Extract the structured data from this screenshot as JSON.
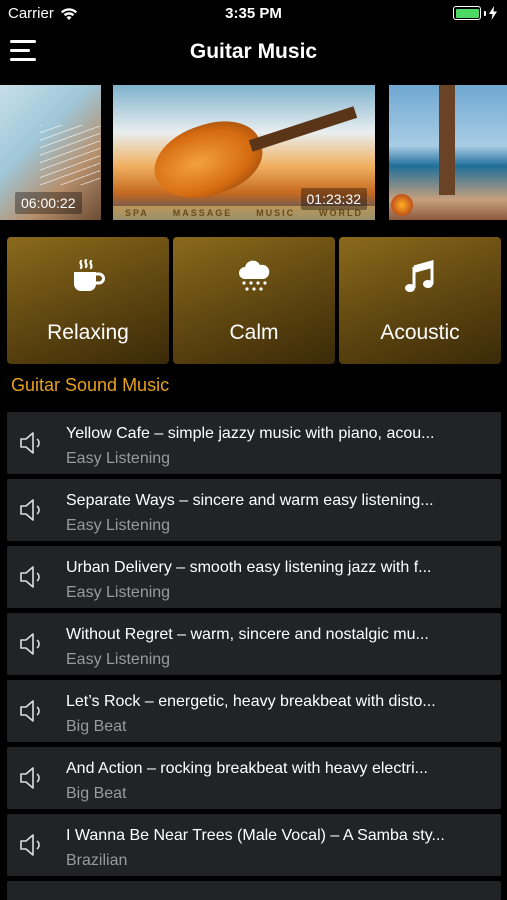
{
  "status": {
    "carrier": "Carrier",
    "time": "3:35 PM",
    "battery_level": 1.0,
    "battery_color": "#4cd964"
  },
  "nav": {
    "title": "Guitar Music"
  },
  "carousel": [
    {
      "duration": "06:00:22"
    },
    {
      "duration": "01:23:32",
      "strip": [
        "SPA",
        "MASSAGE",
        "MUSIC",
        "WORLD"
      ]
    },
    {
      "duration": ""
    }
  ],
  "categories": [
    {
      "label": "Relaxing",
      "icon": "coffee-cup-icon"
    },
    {
      "label": "Calm",
      "icon": "rain-cloud-icon"
    },
    {
      "label": "Acoustic",
      "icon": "music-note-icon"
    }
  ],
  "section_title": "Guitar Sound Music",
  "tracks": [
    {
      "title": "Yellow Cafe – simple jazzy music with piano, acou...",
      "genre": "Easy Listening"
    },
    {
      "title": "Separate Ways – sincere and warm easy listening...",
      "genre": "Easy Listening"
    },
    {
      "title": "Urban Delivery – smooth easy listening jazz with f...",
      "genre": "Easy Listening"
    },
    {
      "title": "Without Regret – warm, sincere and nostalgic mu...",
      "genre": "Easy Listening"
    },
    {
      "title": "Let’s Rock – energetic, heavy breakbeat with disto...",
      "genre": "Big Beat"
    },
    {
      "title": "And Action – rocking breakbeat with heavy electri...",
      "genre": "Big Beat"
    },
    {
      "title": "I Wanna Be Near Trees (Male Vocal) – A Samba sty...",
      "genre": "Brazilian"
    }
  ],
  "colors": {
    "accent": "#e8a01c",
    "tile": "#6a4e14",
    "row": "#222325"
  }
}
